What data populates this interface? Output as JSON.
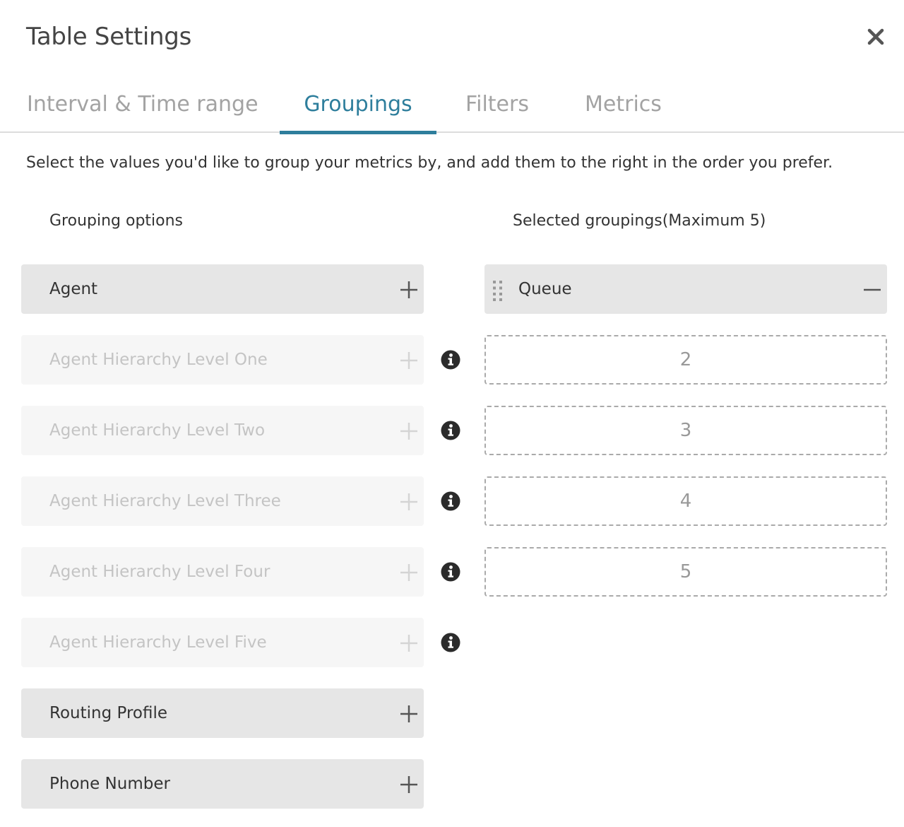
{
  "dialog": {
    "title": "Table Settings",
    "close_icon": "close-icon"
  },
  "tabs": [
    {
      "label": "Interval & Time range",
      "active": false
    },
    {
      "label": "Groupings",
      "active": true
    },
    {
      "label": "Filters",
      "active": false
    },
    {
      "label": "Metrics",
      "active": false
    }
  ],
  "description": "Select the values you'd like to group your metrics by, and add them to the right in the order you prefer.",
  "options": {
    "heading": "Grouping options",
    "items": [
      {
        "label": "Agent",
        "enabled": true,
        "info": false
      },
      {
        "label": "Agent Hierarchy Level One",
        "enabled": false,
        "info": true
      },
      {
        "label": "Agent Hierarchy Level Two",
        "enabled": false,
        "info": true
      },
      {
        "label": "Agent Hierarchy Level Three",
        "enabled": false,
        "info": true
      },
      {
        "label": "Agent Hierarchy Level Four",
        "enabled": false,
        "info": true
      },
      {
        "label": "Agent Hierarchy Level Five",
        "enabled": false,
        "info": true
      },
      {
        "label": "Routing Profile",
        "enabled": true,
        "info": false
      },
      {
        "label": "Phone Number",
        "enabled": true,
        "info": false
      }
    ]
  },
  "selected": {
    "heading": "Selected groupings(Maximum 5)",
    "items": [
      {
        "label": "Queue",
        "filled": true
      },
      {
        "label": "2",
        "filled": false
      },
      {
        "label": "3",
        "filled": false
      },
      {
        "label": "4",
        "filled": false
      },
      {
        "label": "5",
        "filled": false
      }
    ]
  },
  "colors": {
    "accent": "#2e7e9c",
    "enabled_bg": "#e6e6e6",
    "disabled_bg": "#f6f6f6",
    "disabled_text": "#c4c4c4"
  }
}
